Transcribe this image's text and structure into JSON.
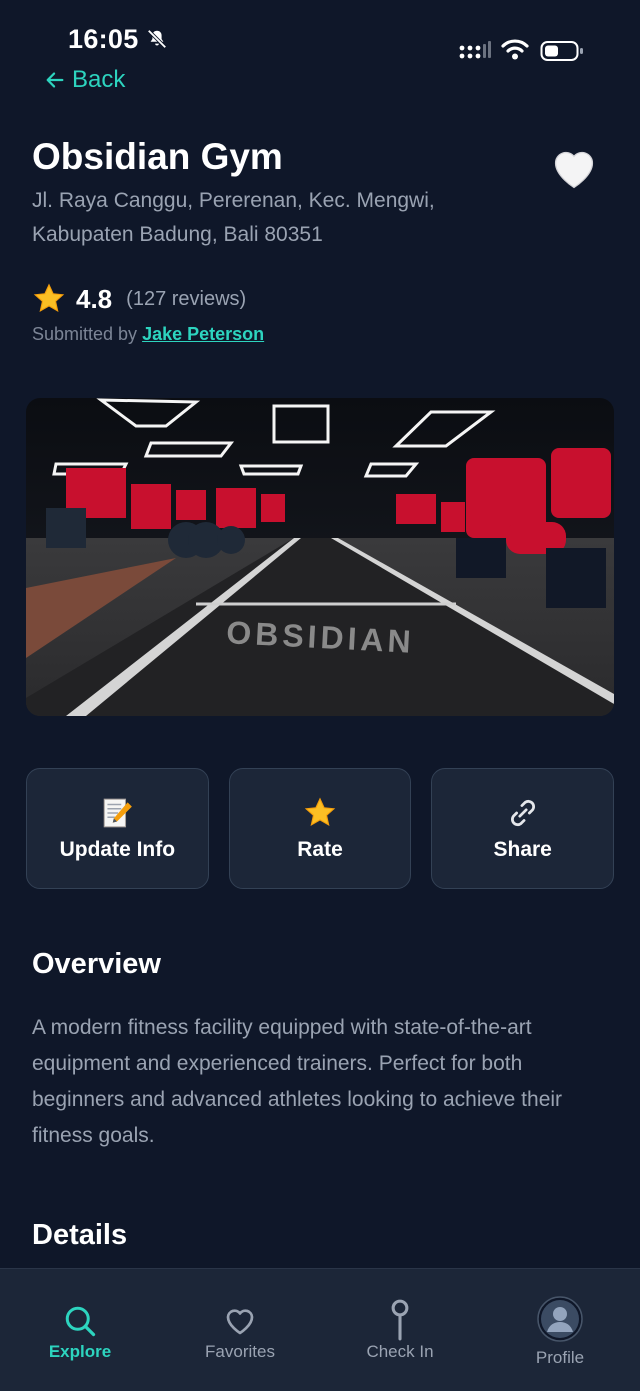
{
  "status_bar": {
    "time": "16:05",
    "icons": [
      "mute-icon",
      "signal-icon",
      "wifi-icon",
      "battery-icon"
    ]
  },
  "nav": {
    "back_label": "Back"
  },
  "gym": {
    "name": "Obsidian Gym",
    "address": "Jl. Raya Canggu, Pererenan, Kec. Mengwi, Kabupaten Badung, Bali 80351",
    "rating": "4.8",
    "reviews": "(127 reviews)",
    "submitted_prefix": "Submitted by",
    "submitted_by": "Jake Peterson",
    "favorite_icon": "heart-icon",
    "image_caption": "OBSIDIAN"
  },
  "actions": [
    {
      "label": "Update Info",
      "icon": "memo-icon"
    },
    {
      "label": "Rate",
      "icon": "star-icon"
    },
    {
      "label": "Share",
      "icon": "link-icon"
    }
  ],
  "overview": {
    "title": "Overview",
    "text": "A modern fitness facility equipped with state-of-the-art equipment and experienced trainers. Perfect for both beginners and advanced athletes looking to achieve their fitness goals."
  },
  "details": {
    "title": "Details"
  },
  "bottom_nav": [
    {
      "label": "Explore",
      "icon": "search-icon",
      "active": true
    },
    {
      "label": "Favorites",
      "icon": "heart-outline-icon",
      "active": false
    },
    {
      "label": "Check In",
      "icon": "pin-icon",
      "active": false
    },
    {
      "label": "Profile",
      "icon": "avatar-icon",
      "active": false
    }
  ],
  "colors": {
    "background": "#0f1729",
    "accent": "#2dd4bf",
    "card": "#1c2638",
    "muted_text": "#9aa3b2"
  }
}
